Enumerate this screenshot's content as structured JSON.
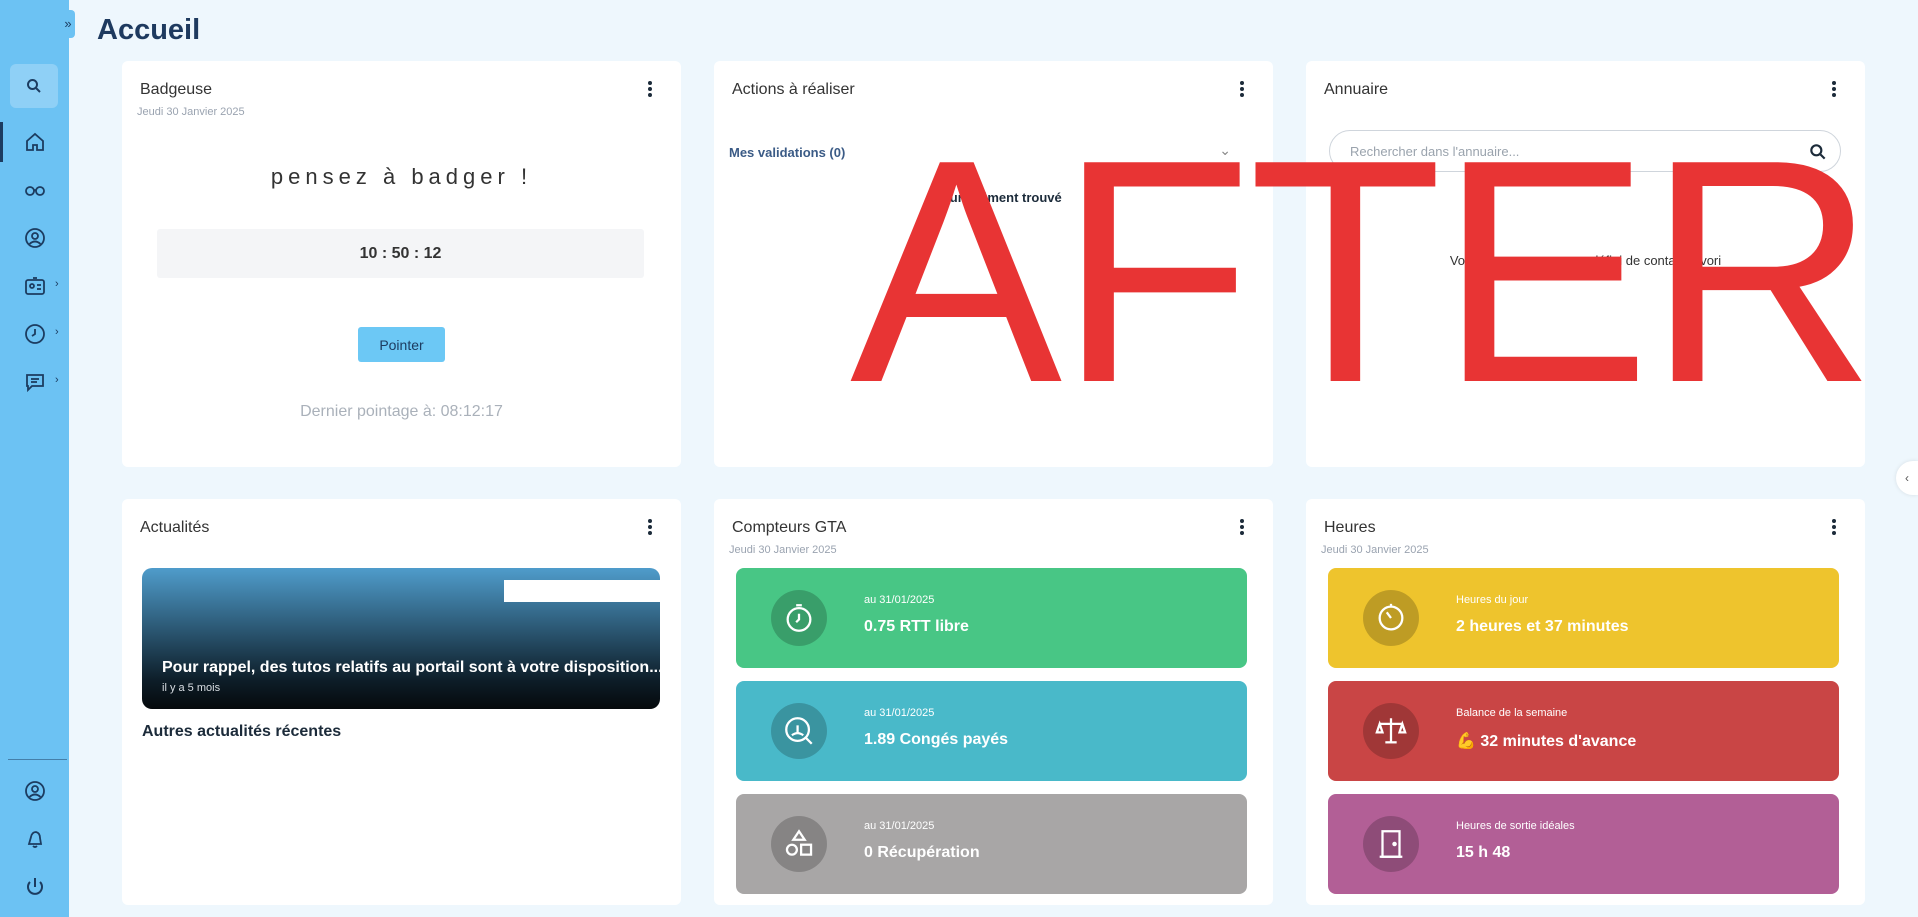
{
  "header": {
    "title": "Accueil",
    "sidebar_toggle": "»",
    "right_handle": "‹"
  },
  "sidebar": {
    "items": [
      {
        "icon": "search-icon"
      },
      {
        "icon": "home-icon"
      },
      {
        "icon": "glasses-icon"
      },
      {
        "icon": "user-circle-icon"
      },
      {
        "icon": "id-card-icon"
      },
      {
        "icon": "clock-icon"
      },
      {
        "icon": "chat-icon"
      },
      {
        "icon": "profile-icon"
      },
      {
        "icon": "bell-icon"
      },
      {
        "icon": "power-icon"
      }
    ],
    "chevron": "›"
  },
  "badgeuse": {
    "title": "Badgeuse",
    "date": "Jeudi 30 Janvier 2025",
    "message": "pensez à badger !",
    "clock": "10 : 50 : 12",
    "button_label": "Pointer",
    "last_punch": "Dernier pointage à: 08:12:17"
  },
  "actions": {
    "title": "Actions à réaliser",
    "validations_label": "Mes validations (0)",
    "chevron": "⌄",
    "empty_text": "Aucun élément trouvé"
  },
  "annuaire": {
    "title": "Annuaire",
    "search_placeholder": "Rechercher dans l'annuaire...",
    "empty_text": "Vous n'avez pas encore défini de contact favori"
  },
  "actualites": {
    "title": "Actualités",
    "news": {
      "title": "Pour rappel, des tutos relatifs au portail sont à votre disposition...",
      "time": "il y a 5 mois"
    },
    "other_label": "Autres actualités récentes"
  },
  "compteurs": {
    "title": "Compteurs GTA",
    "date": "Jeudi 30 Janvier 2025",
    "tiles": [
      {
        "date": "au 31/01/2025",
        "value": "0.75 RTT libre",
        "color": "#48c685",
        "icon": "stopwatch-icon"
      },
      {
        "date": "au 31/01/2025",
        "value": "1.89 Congés payés",
        "color": "#49b9c9",
        "icon": "beach-icon"
      },
      {
        "date": "au 31/01/2025",
        "value": "0 Récupération",
        "color": "#a8a6a6",
        "icon": "shapes-icon"
      }
    ]
  },
  "heures": {
    "title": "Heures",
    "date": "Jeudi 30 Janvier 2025",
    "tiles": [
      {
        "label": "Heures du jour",
        "value": "2 heures et 37 minutes",
        "color": "#eec42d",
        "icon": "timer-icon"
      },
      {
        "label": "Balance de la semaine",
        "value": "💪 32 minutes d'avance",
        "color": "#c94545",
        "icon": "scale-icon"
      },
      {
        "label": "Heures de sortie idéales",
        "value": "15 h 48",
        "color": "#b25f96",
        "icon": "door-icon"
      }
    ]
  },
  "overlay": {
    "text": "AFTER",
    "color": "#e83434"
  }
}
